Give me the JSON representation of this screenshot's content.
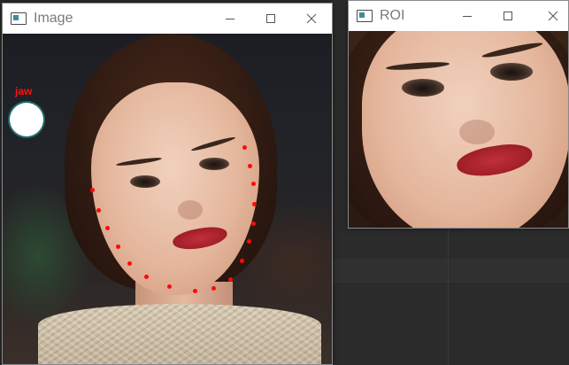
{
  "windows": {
    "image": {
      "title": "Image",
      "annotation_label": "jaw",
      "jaw_point_count": 17
    },
    "roi": {
      "title": "ROI"
    }
  },
  "controls": {
    "minimize": "minimize-icon",
    "maximize": "maximize-icon",
    "close": "close-icon"
  },
  "colors": {
    "titlebar_text": "#7a7a7a",
    "landmark": "#ff0a0a",
    "desktop": "#2b2b2b"
  }
}
